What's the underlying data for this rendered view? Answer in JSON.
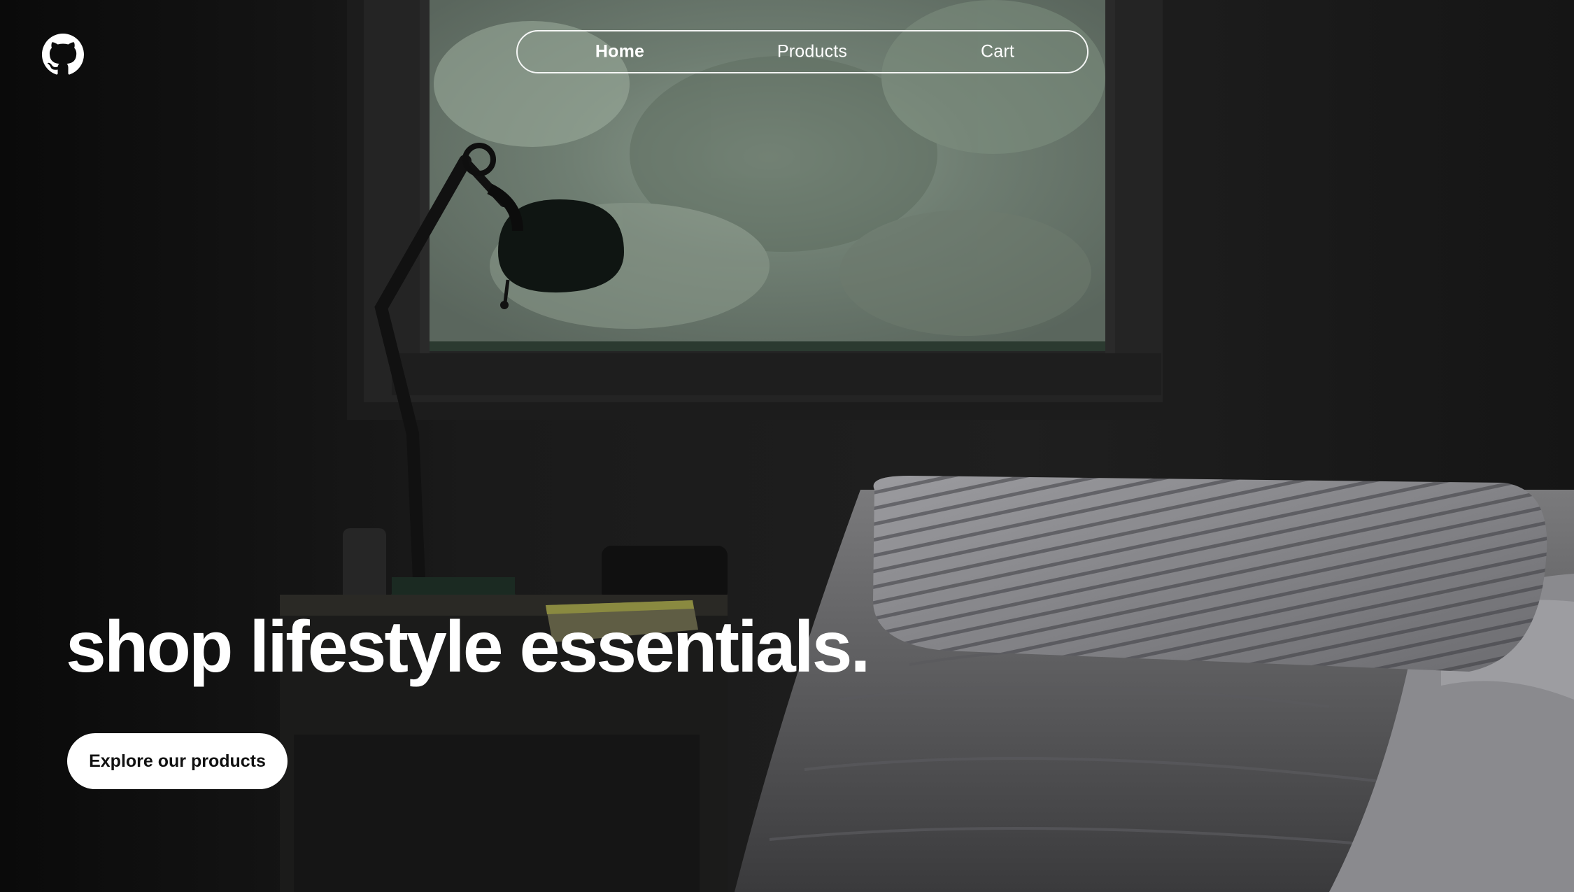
{
  "header": {
    "logo_icon": "github-icon",
    "nav": {
      "home_label": "Home",
      "products_label": "Products",
      "cart_label": "Cart",
      "active": "Home"
    }
  },
  "hero": {
    "headline": "shop lifestyle essentials.",
    "cta_label": "Explore our products"
  },
  "colors": {
    "text": "#ffffff",
    "cta_background": "#ffffff",
    "cta_text": "#111111",
    "page_background": "#0b0b0b"
  }
}
